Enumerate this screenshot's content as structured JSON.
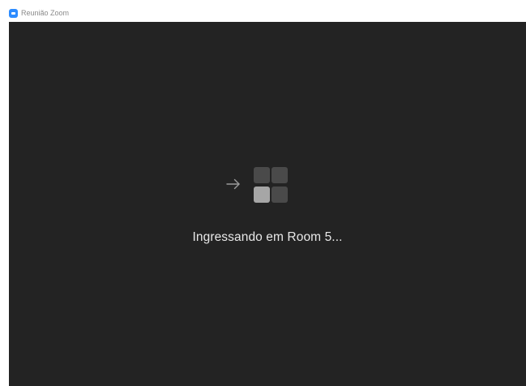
{
  "window": {
    "title": "Reunião Zoom"
  },
  "icons": {
    "app": "zoom-camera-icon",
    "arrow": "arrow-right-icon",
    "grid": "room-grid-icon"
  },
  "status": {
    "message": "Ingressando em Room 5..."
  },
  "colors": {
    "background": "#232323",
    "text": "#e8e8e8",
    "accent": "#2d8cff",
    "tile": "#4a4a4a",
    "tile_highlight": "#a6a6a6"
  }
}
